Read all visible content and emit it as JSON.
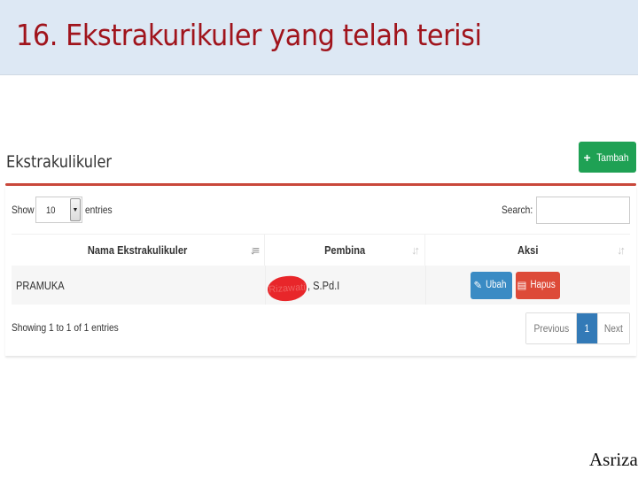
{
  "slide": {
    "title": "16. Ekstrakurikuler yang telah terisi",
    "author": "Asriza"
  },
  "panel": {
    "title": "Ekstrakulikuler",
    "add_button": {
      "icon": "plus-icon",
      "label": "Tambah"
    }
  },
  "table_controls": {
    "length_prefix": "Show",
    "length_value": "10",
    "length_suffix": "entries",
    "search_label": "Search:",
    "search_value": ""
  },
  "table": {
    "columns": [
      {
        "label": "Nama Ekstrakulikuler",
        "sort": "sorted-ascending"
      },
      {
        "label": "Pembina",
        "sort": "unsorted"
      },
      {
        "label": "Aksi",
        "sort": "unsorted"
      }
    ],
    "rows": [
      {
        "nama": "PRAMUKA",
        "pembina_redacted": "Rizawati",
        "pembina_suffix": ", S.Pd.I",
        "actions": [
          {
            "icon": "edit-icon",
            "label": "Ubah"
          },
          {
            "icon": "trash-icon",
            "label": "Hapus"
          }
        ]
      }
    ]
  },
  "footer": {
    "info": "Showing 1 to 1 of 1 entries",
    "pagination": {
      "previous": "Previous",
      "current": "1",
      "next": "Next"
    }
  },
  "colors": {
    "title_red": "#a0141c",
    "header_bg": "#dde8f4",
    "success_green": "#1fa154",
    "primary_blue": "#337ab7",
    "info_blue": "#3a8bc4",
    "danger_red": "#dd4a38",
    "rule_red": "#c9483b"
  }
}
